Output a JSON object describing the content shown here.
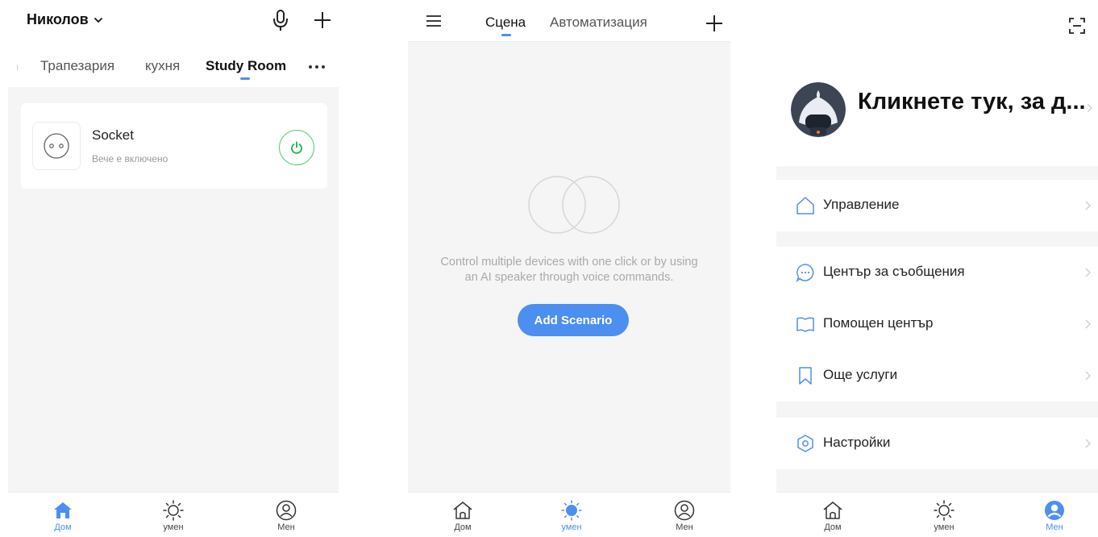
{
  "home_screen": {
    "home_name": "Николов",
    "rooms": [
      {
        "label": "Трапезария",
        "active": false
      },
      {
        "label": "кухня",
        "active": false
      },
      {
        "label": "Study Room",
        "active": true
      }
    ],
    "device": {
      "name": "Socket",
      "status": "Вече е включено",
      "icon": "socket-icon",
      "power_color": "#4cc96b"
    },
    "tabs": [
      {
        "label": "Дом",
        "icon": "home-icon",
        "active": true
      },
      {
        "label": "умен",
        "icon": "sun-icon",
        "active": false
      },
      {
        "label": "Мен",
        "icon": "profile-icon",
        "active": false
      }
    ]
  },
  "scene_screen": {
    "tabs": [
      {
        "label": "Сцена",
        "active": true
      },
      {
        "label": "Автоматизация",
        "active": false
      }
    ],
    "empty_text_line1": "Control multiple devices with one click or by using",
    "empty_text_line2": "an AI speaker through voice commands.",
    "add_button": "Add Scenario",
    "bottom_tabs": [
      {
        "label": "Дом",
        "icon": "home-outline-icon",
        "active": false
      },
      {
        "label": "умен",
        "icon": "sun-icon",
        "active": true
      },
      {
        "label": "Мен",
        "icon": "profile-icon",
        "active": false
      }
    ]
  },
  "me_screen": {
    "profile_name": "Кликнете тук, за д...",
    "menu": [
      {
        "label": "Управление",
        "icon": "house-outline-icon"
      },
      {
        "label": "Център за съобщения",
        "icon": "message-icon"
      },
      {
        "label": "Помощен център",
        "icon": "book-icon"
      },
      {
        "label": "Още услуги",
        "icon": "bookmark-icon"
      },
      {
        "label": "Настройки",
        "icon": "settings-hex-icon"
      }
    ],
    "bottom_tabs": [
      {
        "label": "Дом",
        "icon": "home-outline-icon",
        "active": false
      },
      {
        "label": "умен",
        "icon": "sun-icon",
        "active": false
      },
      {
        "label": "Мен",
        "icon": "profile-icon",
        "active": true
      }
    ]
  },
  "colors": {
    "accent": "#4d8ff0",
    "background": "#f5f5f5",
    "power_green": "#4cc96b"
  }
}
